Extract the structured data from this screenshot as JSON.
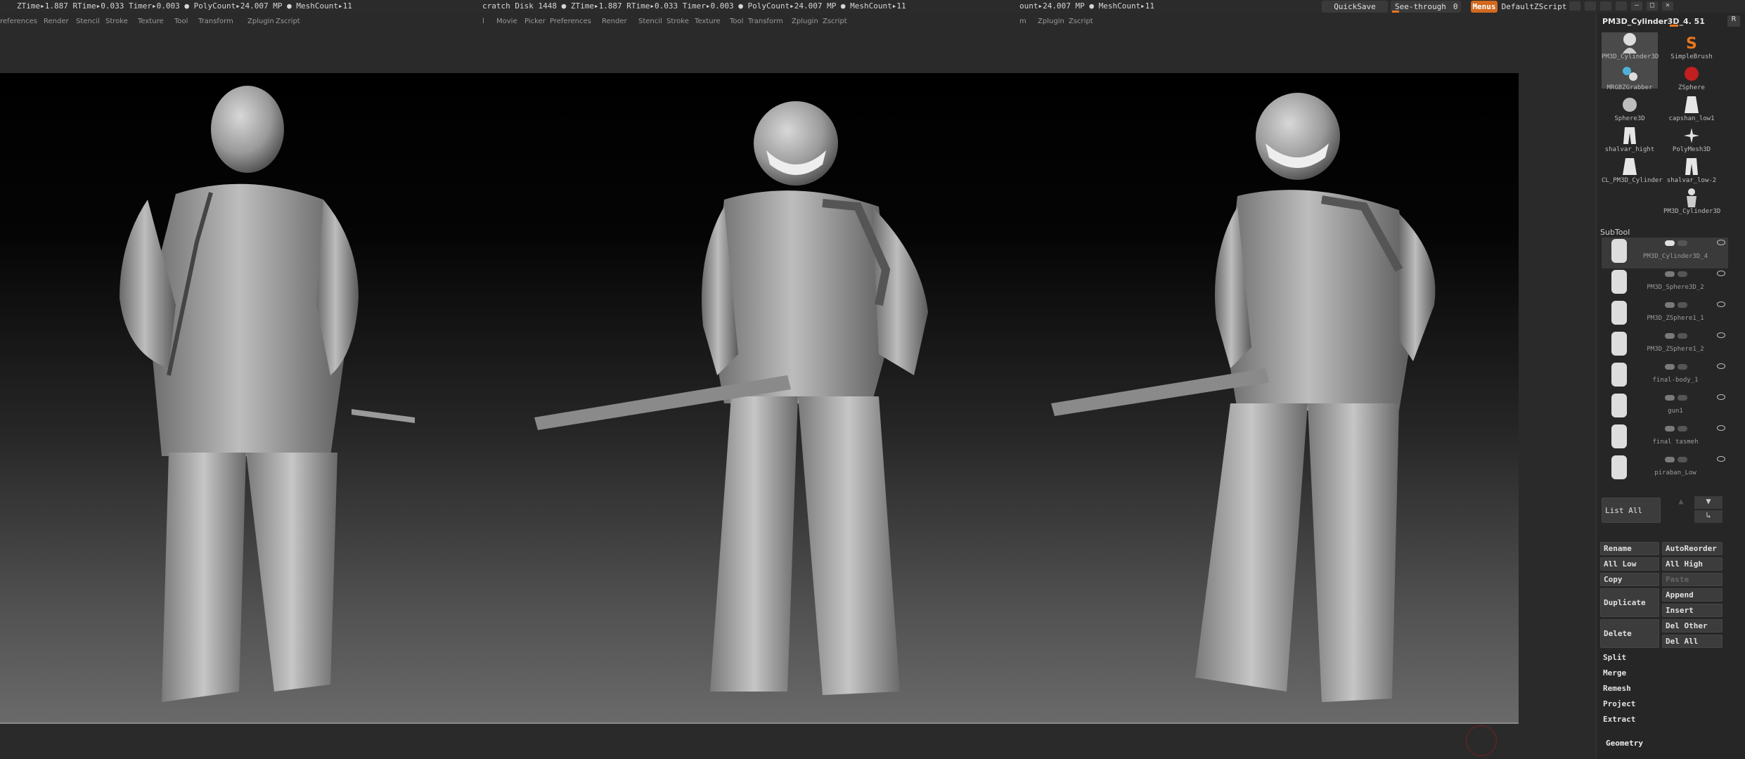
{
  "status": {
    "left": "ZTime▸1.887  RTime▸0.033  Timer▸0.003  ● PolyCount▸24.007 MP  ● MeshCount▸11",
    "mid": "cratch Disk 1448  ●  ZTime▸1.887  RTime▸0.033  Timer▸0.003  ● PolyCount▸24.007 MP  ● MeshCount▸11",
    "right": "ount▸24.007 MP  ● MeshCount▸11"
  },
  "menus": {
    "left": [
      "references",
      "Render",
      "Stencil",
      "Stroke",
      "Texture",
      "Tool",
      "Transform",
      "Zplugin",
      "Zscript"
    ],
    "mid": [
      "l",
      "Movie",
      "Picker",
      "Preferences",
      "Render",
      "Stencil",
      "Stroke",
      "Texture",
      "Tool",
      "Transform",
      "Zplugin",
      "Zscript"
    ],
    "right": [
      "m",
      "Zplugin",
      "Zscript"
    ]
  },
  "topright": {
    "quicksave": "QuickSave",
    "seethrough": "See-through",
    "seethrough_value": "0",
    "menus": "Menus",
    "script": "DefaultZScript"
  },
  "tool": {
    "title": "PM3D_Cylinder3D_4. 51",
    "r_button": "R",
    "thumbs": [
      {
        "label": "PM3D_Cylinder3D",
        "icon": "bust-icon"
      },
      {
        "label": "SimpleBrush",
        "icon": "simplebrush-icon"
      },
      {
        "label": "MRGBZGrabber",
        "icon": "grabber-icon"
      },
      {
        "label": "ZSphere",
        "icon": "zsphere-icon"
      },
      {
        "label": "Sphere3D",
        "icon": "sphere-icon"
      },
      {
        "label": "capshan_low1",
        "icon": "cloth-icon"
      },
      {
        "label": "shalvar_hight",
        "icon": "pants-icon"
      },
      {
        "label": "PolyMesh3D",
        "icon": "star-icon"
      },
      {
        "label": "CL_PM3D_Cylinder",
        "icon": "cloth-icon"
      },
      {
        "label": "shalvar_low-2",
        "icon": "pants-icon"
      },
      {
        "label": "PM3D_Cylinder3D",
        "icon": "figure-icon"
      }
    ]
  },
  "subtool": {
    "title": "SubTool",
    "items": [
      {
        "name": "PM3D_Cylinder3D_4"
      },
      {
        "name": "PM3D_Sphere3D_2"
      },
      {
        "name": "PM3D_ZSphere1_1"
      },
      {
        "name": "PM3D_ZSphere1_2"
      },
      {
        "name": "final-body_1"
      },
      {
        "name": "gun1"
      },
      {
        "name": "final tasmeh"
      },
      {
        "name": "piraban_Low"
      }
    ],
    "list_all": "List All"
  },
  "actions": {
    "rename": "Rename",
    "autoreorder": "AutoReorder",
    "all_low": "All Low",
    "all_high": "All High",
    "copy": "Copy",
    "paste": "Paste",
    "duplicate": "Duplicate",
    "append": "Append",
    "insert": "Insert",
    "delete": "Delete",
    "del_other": "Del Other",
    "del_all": "Del All",
    "split": "Split",
    "merge": "Merge",
    "remesh": "Remesh",
    "project": "Project",
    "extract": "Extract",
    "geometry": "Geometry"
  },
  "colors": {
    "accent": "#e8761c",
    "menus_bg": "#d2691e",
    "viewport_top": "#000000",
    "viewport_bottom": "#6a6a6a"
  }
}
